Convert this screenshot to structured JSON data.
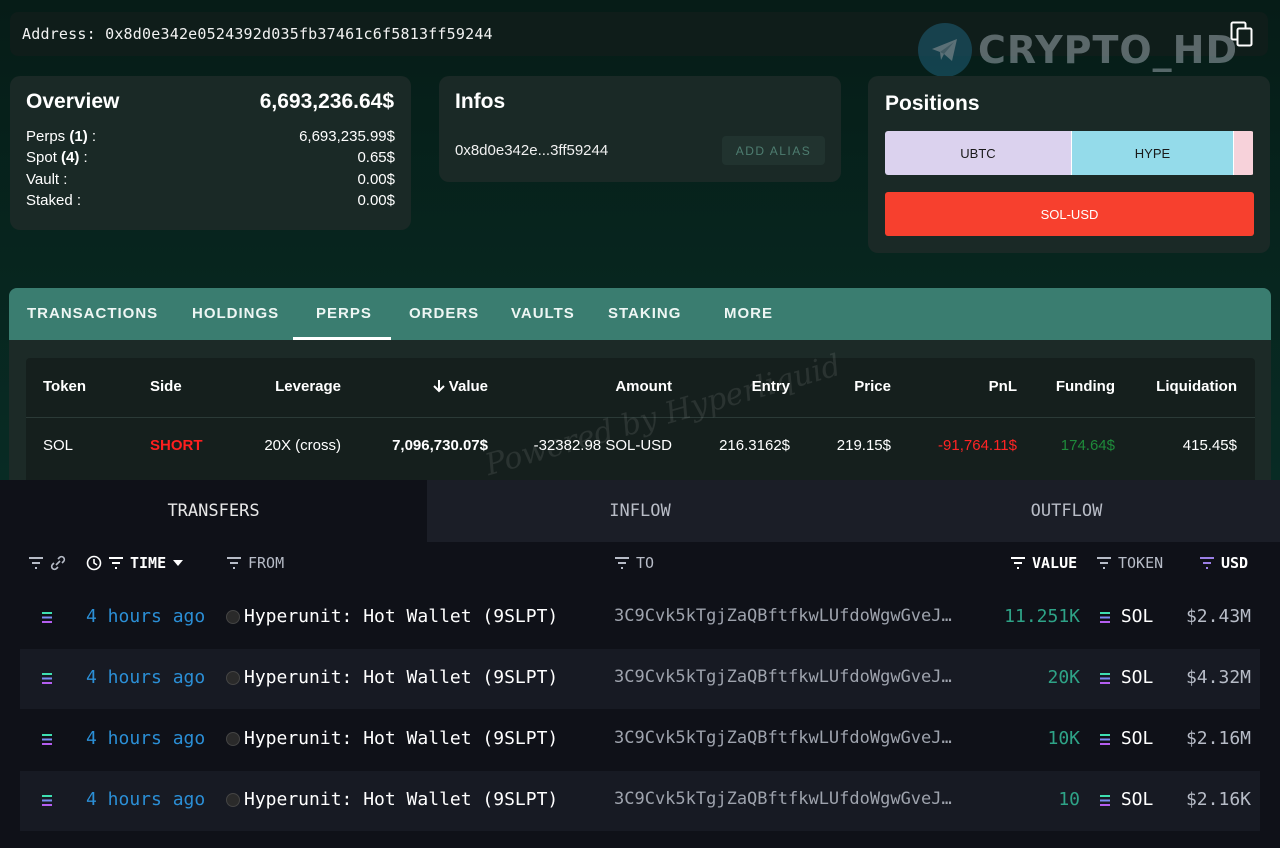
{
  "address_bar": {
    "label": "Address:",
    "address": "0x8d0e342e0524392d035fb37461c6f5813ff59244"
  },
  "watermark": {
    "text": "CRYPTO_HD"
  },
  "overview": {
    "title": "Overview",
    "total": "6,693,236.64$",
    "rows": [
      {
        "label": "Perps",
        "count": "(1)",
        "value": "6,693,235.99$"
      },
      {
        "label": "Spot",
        "count": "(4)",
        "value": "0.65$"
      },
      {
        "label": "Vault :",
        "count": "",
        "value": "0.00$"
      },
      {
        "label": "Staked :",
        "count": "",
        "value": "0.00$"
      }
    ]
  },
  "infos": {
    "title": "Infos",
    "short_address": "0x8d0e342e...3ff59244",
    "alias_button": "ADD ALIAS"
  },
  "positions": {
    "title": "Positions",
    "segments": [
      {
        "label": "UBTC",
        "color": "#dbd2ee",
        "share": 0.505
      },
      {
        "label": "HYPE",
        "color": "#94dbea",
        "share": 0.44
      },
      {
        "label": "",
        "color": "#f7d2da",
        "share": 0.055
      }
    ],
    "sol": {
      "label": "SOL-USD",
      "color": "#f7402e"
    }
  },
  "tabs": [
    "TRANSACTIONS",
    "HOLDINGS",
    "PERPS",
    "ORDERS",
    "VAULTS",
    "STAKING",
    "MORE"
  ],
  "active_tab": "PERPS",
  "perps_table": {
    "headers": [
      "Token",
      "Side",
      "Leverage",
      "Value",
      "Amount",
      "Entry",
      "Price",
      "PnL",
      "Funding",
      "Liquidation"
    ],
    "row": {
      "token": "SOL",
      "side": "SHORT",
      "leverage": "20X (cross)",
      "value": "7,096,730.07$",
      "amount": "-32382.98 SOL-USD",
      "entry": "216.3162$",
      "price": "219.15$",
      "pnl": "-91,764.11$",
      "funding": "174.64$",
      "liquidation": "415.45$"
    },
    "watermark": "Powered by Hyperliquid"
  },
  "transfers": {
    "tabs": [
      "TRANSFERS",
      "INFLOW",
      "OUTFLOW"
    ],
    "headers": {
      "time": "TIME",
      "from": "FROM",
      "to": "TO",
      "value": "VALUE",
      "token": "TOKEN",
      "usd": "USD"
    },
    "rows": [
      {
        "time": "4 hours ago",
        "from": "Hyperunit: Hot Wallet (9SLPT)",
        "to": "3C9Cvk5kTgjZaQBftfkwLUfdoWgwGveJ…",
        "value": "11.251K",
        "token": "SOL",
        "usd": "$2.43M"
      },
      {
        "time": "4 hours ago",
        "from": "Hyperunit: Hot Wallet (9SLPT)",
        "to": "3C9Cvk5kTgjZaQBftfkwLUfdoWgwGveJ…",
        "value": "20K",
        "token": "SOL",
        "usd": "$4.32M"
      },
      {
        "time": "4 hours ago",
        "from": "Hyperunit: Hot Wallet (9SLPT)",
        "to": "3C9Cvk5kTgjZaQBftfkwLUfdoWgwGveJ…",
        "value": "10K",
        "token": "SOL",
        "usd": "$2.16M"
      },
      {
        "time": "4 hours ago",
        "from": "Hyperunit: Hot Wallet (9SLPT)",
        "to": "3C9Cvk5kTgjZaQBftfkwLUfdoWgwGveJ…",
        "value": "10",
        "token": "SOL",
        "usd": "$2.16K"
      }
    ]
  },
  "colors": {
    "short": "#ff1f1f",
    "pnl_negative": "#ff2424",
    "funding_positive": "#1e8a3a",
    "accent_tab": "#3a7d70"
  },
  "icons": {
    "copy": "copy-icon",
    "telegram": "telegram-icon",
    "filter": "filter-icon",
    "clock": "clock-icon",
    "link": "link-icon",
    "sol": "solana-icon",
    "sort": "sort-down-arrow-icon"
  }
}
